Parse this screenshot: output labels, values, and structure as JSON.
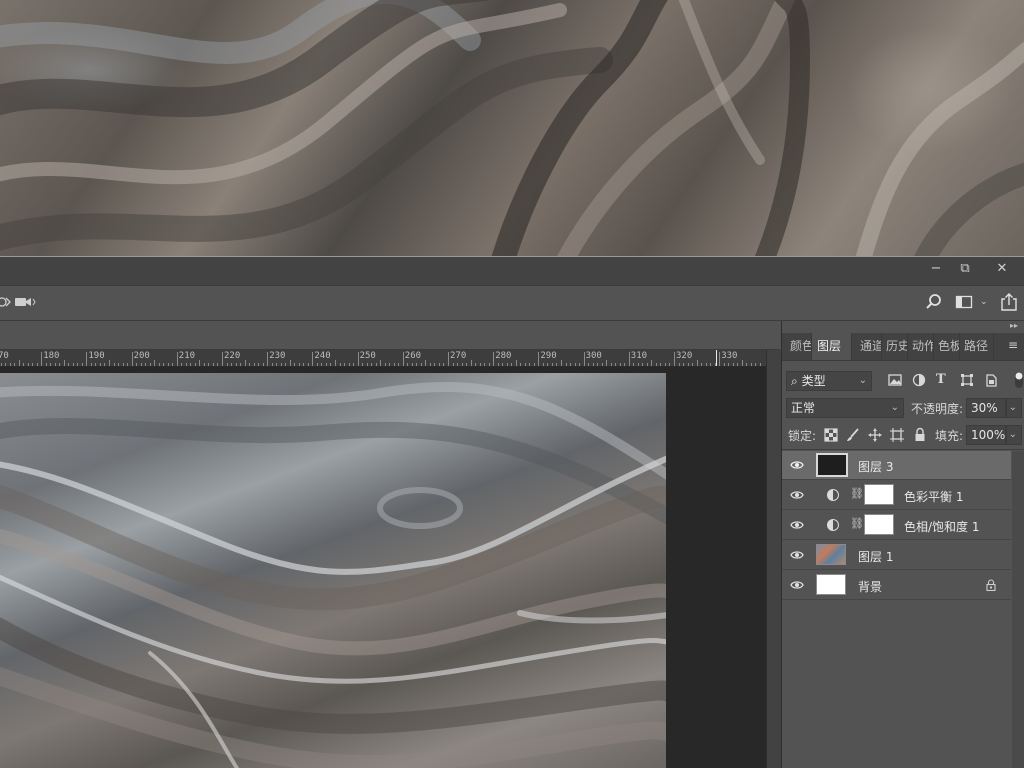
{
  "window": {
    "minimize_label": "−",
    "restore_label": "⧉",
    "close_label": "✕"
  },
  "colors": {
    "panel_bg": "#535353",
    "dark_bg": "#282828",
    "selected_row": "#6a6a6a"
  },
  "icons": {
    "options_left": "3d-orbit-icon",
    "video": "video-camera-icon",
    "search": "search-icon",
    "workspace": "workspace-layout-icon",
    "share": "share-icon"
  },
  "ruler": {
    "labels": [
      "70",
      "180",
      "190",
      "200",
      "210",
      "220",
      "230",
      "240",
      "250",
      "260",
      "270",
      "280",
      "290",
      "300",
      "310",
      "320",
      "330"
    ]
  },
  "panels": {
    "collapse_label": "▸▸",
    "menu_label": "≡",
    "tabs": [
      {
        "label": "颜色",
        "active": false
      },
      {
        "label": "图层",
        "active": true
      },
      {
        "label": "通道",
        "active": false
      },
      {
        "label": "历史",
        "active": false
      },
      {
        "label": "动作",
        "active": false
      },
      {
        "label": "色板",
        "active": false
      },
      {
        "label": "路径",
        "active": false
      }
    ]
  },
  "layers_panel": {
    "filter": {
      "prefix": "⌕",
      "value": "类型",
      "icons": [
        "image-filter-icon",
        "adjustment-filter-icon",
        "type-filter-icon",
        "shape-filter-icon",
        "smart-object-filter-icon",
        "filter-toggle-icon"
      ]
    },
    "blend_mode": "正常",
    "opacity_label": "不透明度:",
    "opacity_value": "30%",
    "lock_label": "锁定:",
    "lock_icons": [
      "lock-transparent-pixels-icon",
      "lock-image-pixels-icon",
      "lock-position-icon",
      "lock-artboard-icon",
      "lock-all-icon"
    ],
    "fill_label": "填充:",
    "fill_value": "100%",
    "layers": [
      {
        "name": "图层 3",
        "type": "pixel",
        "thumb": "#1e1e1e",
        "selected": true,
        "visible": true
      },
      {
        "name": "色彩平衡 1",
        "type": "adjustment",
        "thumb": "#ffffff",
        "selected": false,
        "visible": true
      },
      {
        "name": "色相/饱和度 1",
        "type": "adjustment",
        "thumb": "#ffffff",
        "selected": false,
        "visible": true
      },
      {
        "name": "图层 1",
        "type": "image",
        "thumb": "marble",
        "selected": false,
        "visible": true
      },
      {
        "name": "背景",
        "type": "background",
        "thumb": "#ffffff",
        "selected": false,
        "visible": true,
        "locked": true
      }
    ]
  }
}
